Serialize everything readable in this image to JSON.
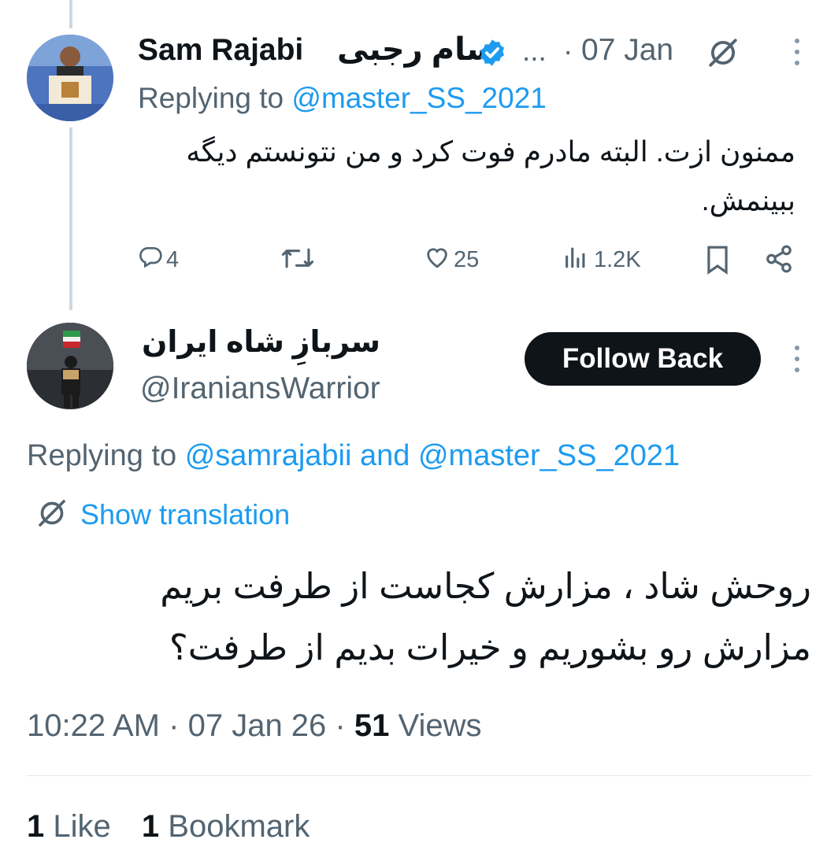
{
  "reply_tweet": {
    "author_name": "Sam Rajabi",
    "author_name_fa": "سام رجبی",
    "ellipsis": "...",
    "separator": "·",
    "date": "07 Jan",
    "replying_prefix": "Replying to",
    "replying_to": "@master_SS_2021",
    "text_line1": "ممنون ازت. البته مادرم فوت کرد و من نتونستم دیگه",
    "text_line2": "ببینمش.",
    "actions": {
      "replies": "4",
      "likes": "25",
      "views": "1.2K"
    }
  },
  "main_tweet": {
    "author_name": "سربازِ شاه ایران",
    "handle": "@IraniansWarrior",
    "follow_label": "Follow Back",
    "replying_prefix": "Replying to",
    "replying_user1": "@samrajabii",
    "and_word": "and",
    "replying_user2": "@master_SS_2021",
    "translate_label": "Show translation",
    "text_line1": "روحش شاد ، مزارش کجاست از طرفت بریم",
    "text_line2": "مزارش رو بشوریم و خیرات بدیم از طرفت؟",
    "time": "10:22 AM",
    "sep1": "·",
    "date": "07 Jan 26",
    "sep2": "·",
    "views_count": "51",
    "views_label": "Views"
  },
  "engagement": {
    "likes_count": "1",
    "likes_label": "Like",
    "bookmarks_count": "1",
    "bookmarks_label": "Bookmark"
  },
  "colors": {
    "link": "#1d9bf0",
    "secondary_text": "#536471",
    "verified_badge": "#1d9bf0",
    "button_bg": "#0f1419"
  },
  "icons": [
    "verified-badge-icon",
    "grok-icon",
    "more-icon",
    "reply-icon",
    "retweet-icon",
    "like-icon",
    "views-icon",
    "bookmark-icon",
    "share-icon",
    "translate-icon"
  ]
}
